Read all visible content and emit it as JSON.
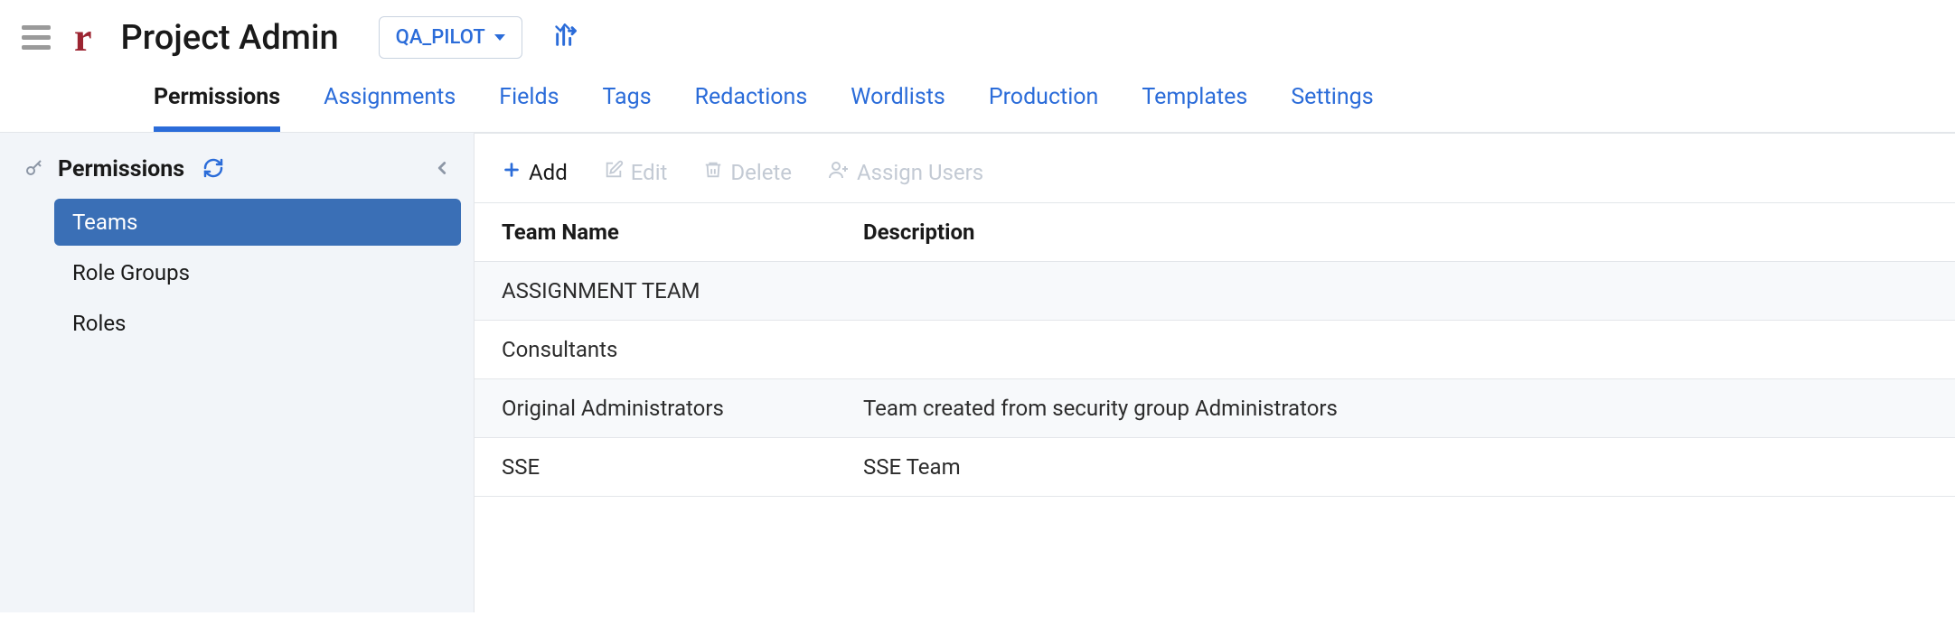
{
  "header": {
    "page_title": "Project Admin",
    "project_name": "QA_PILOT"
  },
  "tabs": [
    {
      "label": "Permissions",
      "active": true
    },
    {
      "label": "Assignments",
      "active": false
    },
    {
      "label": "Fields",
      "active": false
    },
    {
      "label": "Tags",
      "active": false
    },
    {
      "label": "Redactions",
      "active": false
    },
    {
      "label": "Wordlists",
      "active": false
    },
    {
      "label": "Production",
      "active": false
    },
    {
      "label": "Templates",
      "active": false
    },
    {
      "label": "Settings",
      "active": false
    }
  ],
  "sidebar": {
    "title": "Permissions",
    "items": [
      {
        "label": "Teams",
        "active": true
      },
      {
        "label": "Role Groups",
        "active": false
      },
      {
        "label": "Roles",
        "active": false
      }
    ]
  },
  "toolbar": {
    "add_label": "Add",
    "edit_label": "Edit",
    "delete_label": "Delete",
    "assign_users_label": "Assign Users"
  },
  "table": {
    "columns": {
      "team_name": "Team Name",
      "description": "Description"
    },
    "rows": [
      {
        "team_name": "ASSIGNMENT TEAM",
        "description": ""
      },
      {
        "team_name": "Consultants",
        "description": ""
      },
      {
        "team_name": "Original Administrators",
        "description": "Team created from security group Administrators"
      },
      {
        "team_name": "SSE",
        "description": "SSE Team"
      }
    ]
  }
}
